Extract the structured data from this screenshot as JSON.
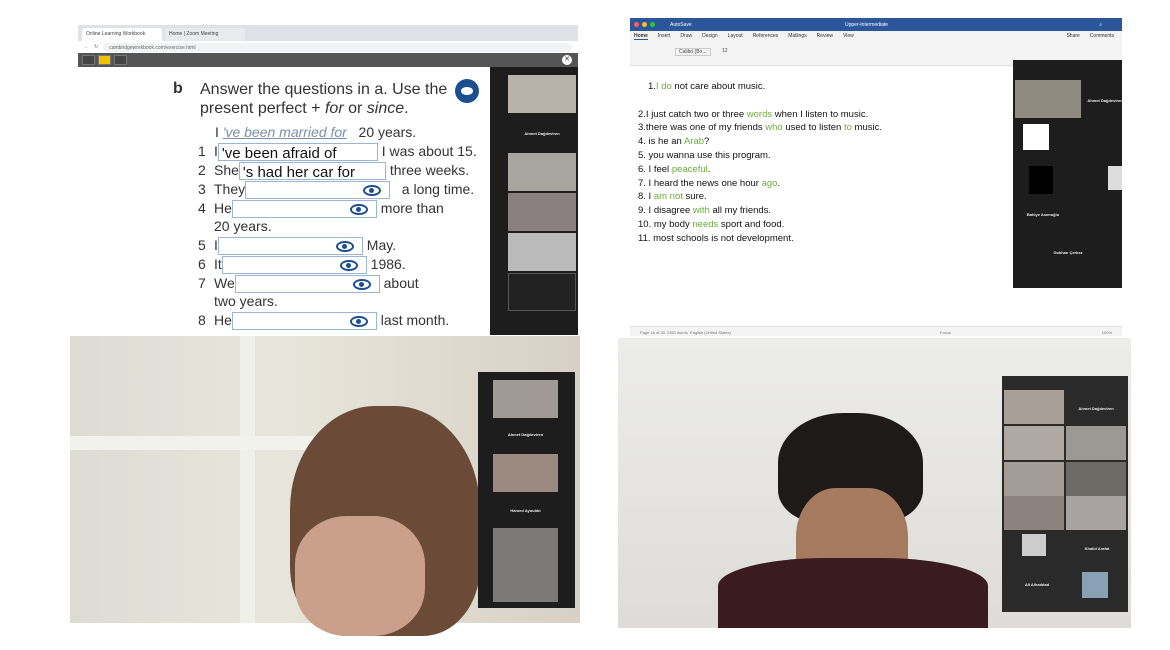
{
  "browser": {
    "tabs": [
      "Online Learning Workbook",
      "Home | Zoom Meeting"
    ],
    "url": "cambridgeworkbook.com/exercise.html"
  },
  "exercise": {
    "letter": "b",
    "instruction_a": "Answer the questions in a. Use the",
    "instruction_b": "present perfect + ",
    "for": "for",
    "or": " or ",
    "since": "since",
    "example": {
      "subject": "I",
      "answer": "'ve been married for",
      "end": "20 years."
    },
    "items": [
      {
        "n": "1",
        "subject": "I",
        "answer": "'ve been afraid of",
        "end": "I was about 15."
      },
      {
        "n": "2",
        "subject": "She",
        "answer": "'s had her car for",
        "end": "three weeks."
      },
      {
        "n": "3",
        "subject": "They",
        "answer": "",
        "end": "a long time."
      },
      {
        "n": "4",
        "subject": "He",
        "answer": "",
        "end": "more than",
        "end2": "20 years."
      },
      {
        "n": "5",
        "subject": "I",
        "answer": "",
        "end": "May."
      },
      {
        "n": "6",
        "subject": "It",
        "answer": "",
        "end": "1986."
      },
      {
        "n": "7",
        "subject": "We",
        "answer": "",
        "end": "about",
        "end2": "two years."
      },
      {
        "n": "8",
        "subject": "He",
        "answer": "",
        "end": "last month."
      }
    ]
  },
  "zoom1": {
    "names": [
      "Ahmet Dağdeviren"
    ]
  },
  "word": {
    "title": "Upper-Intermediate",
    "autosave": "AutoSave",
    "tabs": [
      "Home",
      "Insert",
      "Draw",
      "Design",
      "Layout",
      "References",
      "Mailings",
      "Review",
      "View"
    ],
    "share": "Share",
    "comments": "Comments",
    "font": "Calibri (Bo...",
    "size": "12",
    "lines": [
      [
        {
          "t": "1."
        },
        {
          "t": "I do",
          "g": true
        },
        {
          "t": " not care about music."
        }
      ],
      [
        {
          "t": ""
        }
      ],
      [
        {
          "t": "2.I just catch two or three "
        },
        {
          "t": "words",
          "g": true
        },
        {
          "t": " when I listen to music."
        }
      ],
      [
        {
          "t": "3.there was one of my friends "
        },
        {
          "t": "who",
          "g": true
        },
        {
          "t": " used to listen "
        },
        {
          "t": "to",
          "g": true
        },
        {
          "t": " music."
        }
      ],
      [
        {
          "t": "4. is he an "
        },
        {
          "t": "Arab",
          "g": true
        },
        {
          "t": "?"
        }
      ],
      [
        {
          "t": "5. you wanna use this program."
        }
      ],
      [
        {
          "t": "6. I feel "
        },
        {
          "t": "peaceful",
          "g": true
        },
        {
          "t": "."
        }
      ],
      [
        {
          "t": "7. I heard the news one hour "
        },
        {
          "t": "ago",
          "g": true
        },
        {
          "t": "."
        }
      ],
      [
        {
          "t": "8. I "
        },
        {
          "t": "am not",
          "g": true
        },
        {
          "t": " sure."
        }
      ],
      [
        {
          "t": "9. I disagree "
        },
        {
          "t": "with",
          "g": true
        },
        {
          "t": " all my friends."
        }
      ],
      [
        {
          "t": "10. my body "
        },
        {
          "t": "needs",
          "g": true
        },
        {
          "t": " sport and food."
        }
      ],
      [
        {
          "t": "11. most schools is not development."
        }
      ]
    ],
    "status": {
      "page": "Page 16 of 30",
      "words": "2351 words",
      "lang": "English (United States)",
      "focus": "Focus",
      "zoom": "100%"
    }
  },
  "zoom2": {
    "names": [
      "Ahmet Dağdeviren",
      "Bahiye Asımoğlu",
      "Gokhan Çerkez"
    ]
  },
  "zoom3": {
    "names": [
      "Ahmet Dağdeviren",
      "Hamed Ayoubbi"
    ]
  },
  "zoom4": {
    "names": [
      "Ahmet Dağdeviren",
      "Khalid Arafat",
      "Ali Alhaddad"
    ]
  }
}
